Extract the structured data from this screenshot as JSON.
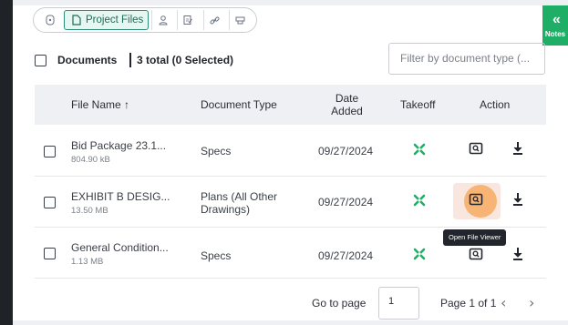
{
  "tabs": [
    {
      "icon": "document-icon",
      "label": ""
    },
    {
      "icon": "file-icon",
      "label": "Project Files"
    },
    {
      "icon": "person-icon",
      "label": ""
    },
    {
      "icon": "clipboard-edit-icon",
      "label": ""
    },
    {
      "icon": "link-icon",
      "label": ""
    },
    {
      "icon": "stamp-icon",
      "label": ""
    }
  ],
  "notes": {
    "label": "Notes"
  },
  "header": {
    "title": "Documents",
    "total": "3 total (0 Selected)"
  },
  "filter": {
    "placeholder": "Filter by document type (..."
  },
  "columns": {
    "file_name": "File Name",
    "document_type": "Document Type",
    "date_added_line1": "Date",
    "date_added_line2": "Added",
    "takeoff": "Takeoff",
    "action": "Action"
  },
  "rows": [
    {
      "name": "Bid Package 23.1...",
      "size": "804.90 kB",
      "type_line1": "Specs",
      "type_line2": "",
      "date": "09/27/2024"
    },
    {
      "name": "EXHIBIT B DESIG...",
      "size": "13.50 MB",
      "type_line1": "Plans (All Other",
      "type_line2": "Drawings)",
      "date": "09/27/2024"
    },
    {
      "name": "General Condition...",
      "size": "1.13 MB",
      "type_line1": "Specs",
      "type_line2": "",
      "date": "09/27/2024"
    }
  ],
  "tooltip": "Open File Viewer",
  "pagination": {
    "goto_label": "Go to page",
    "page_value": "1",
    "page_of": "Page 1 of 1"
  },
  "colors": {
    "accent": "#1fae66",
    "active_tab": "#2d8f78",
    "highlight": "#f7aa62"
  }
}
